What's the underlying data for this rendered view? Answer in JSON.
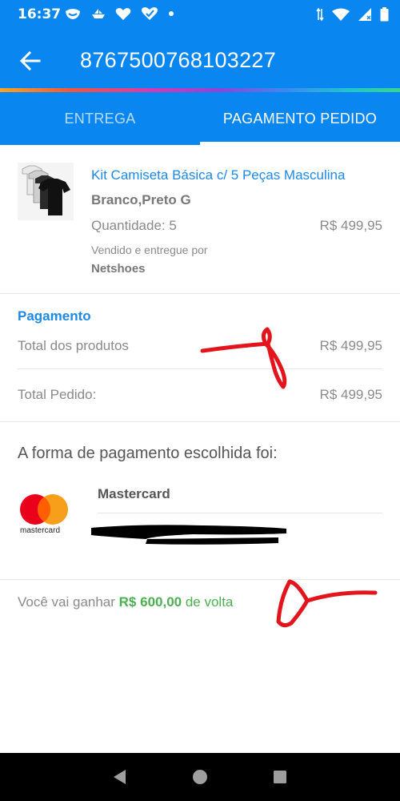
{
  "status_bar": {
    "time": "16:37",
    "icons_left": [
      "grin-face-icon",
      "boat-icon",
      "heart-icon",
      "heart-check-icon",
      "dot-icon"
    ],
    "icons_right": [
      "data-arrows-icon",
      "wifi-icon",
      "signal-icon",
      "battery-icon"
    ]
  },
  "app_bar": {
    "order_number": "8767500768103227"
  },
  "tabs": [
    {
      "label": "ENTREGA",
      "active": false
    },
    {
      "label": "PAGAMENTO PEDIDO",
      "active": true
    }
  ],
  "product": {
    "name": "Kit Camiseta Básica c/ 5 Peças Masculina",
    "variant": "Branco,Preto G",
    "quantity_label": "Quantidade: 5",
    "price": "R$ 499,95",
    "sold_by_label": "Vendido e entregue por",
    "seller": "Netshoes"
  },
  "payment": {
    "title": "Pagamento",
    "rows": [
      {
        "label": "Total dos produtos",
        "value": "R$ 499,95"
      },
      {
        "label": "Total Pedido:",
        "value": "R$ 499,95"
      }
    ]
  },
  "method": {
    "title": "A forma de pagamento escolhida foi:",
    "card_brand": "Mastercard",
    "logo_text": "mastercard"
  },
  "cashback": {
    "prefix": "Você vai ganhar",
    "amount": "R$ 600,00",
    "suffix": "de volta"
  },
  "colors": {
    "primary": "#0a86f0",
    "link": "#1e88e5",
    "cashback_green": "#4caf50",
    "annotation_red": "#e3141b"
  }
}
